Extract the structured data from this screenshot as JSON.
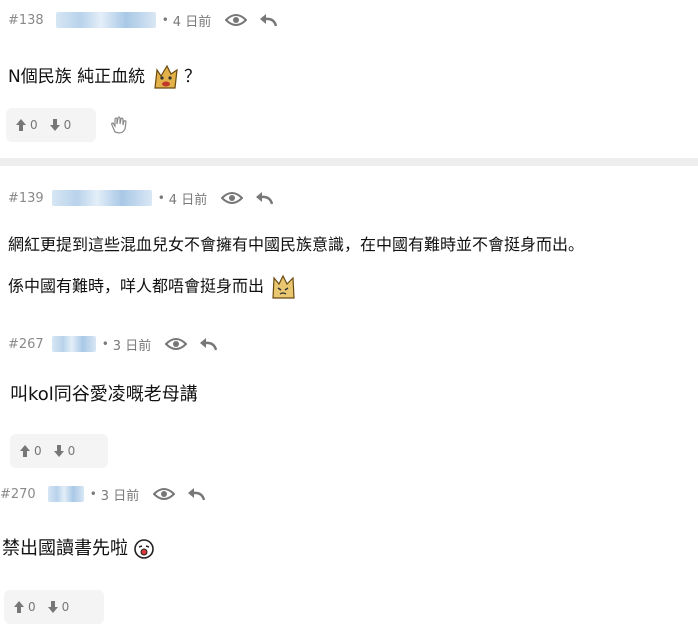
{
  "posts": [
    {
      "number": "#138",
      "time": "4 日前",
      "lines": [
        "N個民族 純正血統",
        "？"
      ],
      "upvotes": "0",
      "downvotes": "0"
    },
    {
      "number": "#139",
      "time": "4 日前",
      "lines": [
        "網紅更提到這些混血兒女不會擁有中國民族意識，在中國有難時並不會挺身而出。",
        "係中國有難時，咩人都唔會挺身而出"
      ]
    },
    {
      "number": "#267",
      "time": "3 日前",
      "lines": [
        "叫kol同谷愛凌嘅老母講"
      ],
      "upvotes": "0",
      "downvotes": "0"
    },
    {
      "number": "#270",
      "time": "3 日前",
      "lines": [
        "禁出國讀書先啦"
      ],
      "upvotes": "0",
      "downvotes": "0"
    }
  ],
  "separator": "•",
  "colors": {
    "meta": "#7a7a7a",
    "vote_bg": "#f4f4f4",
    "divider": "#eeeeee"
  },
  "icons": [
    "eye-icon",
    "reply-icon",
    "upvote-icon",
    "downvote-icon",
    "hand-icon",
    "emoji-sticker"
  ]
}
